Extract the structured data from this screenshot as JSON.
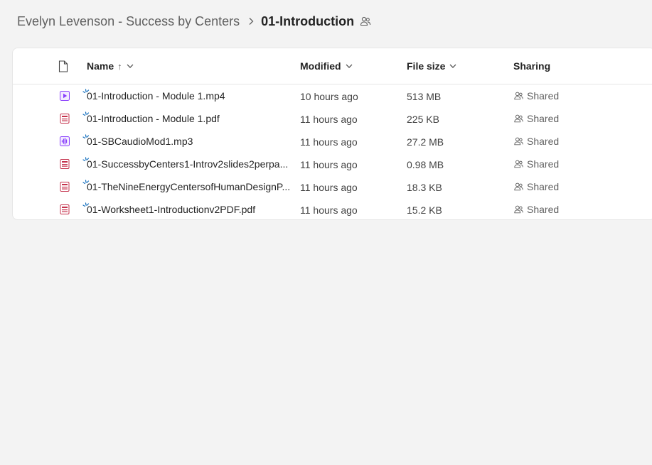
{
  "breadcrumb": {
    "parent": "Evelyn Levenson - Success by Centers",
    "current": "01-Introduction"
  },
  "columns": {
    "name": "Name",
    "name_sort_arrow": "↑",
    "modified": "Modified",
    "file_size": "File size",
    "sharing": "Sharing"
  },
  "files": [
    {
      "name": "01-Introduction - Module 1.mp4",
      "modified": "10 hours ago",
      "size": "513 MB",
      "sharing": "Shared",
      "icon": "video-file-icon"
    },
    {
      "name": "01-Introduction - Module 1.pdf",
      "modified": "11 hours ago",
      "size": "225 KB",
      "sharing": "Shared",
      "icon": "pdf-file-icon"
    },
    {
      "name": "01-SBCaudioMod1.mp3",
      "modified": "11 hours ago",
      "size": "27.2 MB",
      "sharing": "Shared",
      "icon": "audio-file-icon"
    },
    {
      "name": "01-SuccessbyCenters1-Introv2slides2perpa...",
      "modified": "11 hours ago",
      "size": "0.98 MB",
      "sharing": "Shared",
      "icon": "pdf-file-icon"
    },
    {
      "name": "01-TheNineEnergyCentersofHumanDesignP...",
      "modified": "11 hours ago",
      "size": "18.3 KB",
      "sharing": "Shared",
      "icon": "pdf-file-icon"
    },
    {
      "name": "01-Worksheet1-Introductionv2PDF.pdf",
      "modified": "11 hours ago",
      "size": "15.2 KB",
      "sharing": "Shared",
      "icon": "pdf-file-icon"
    }
  ],
  "colors": {
    "video": "#8a3ffc",
    "audio": "#8a3ffc",
    "pdf": "#c4314b",
    "new_marker": "#0f6cbd"
  }
}
